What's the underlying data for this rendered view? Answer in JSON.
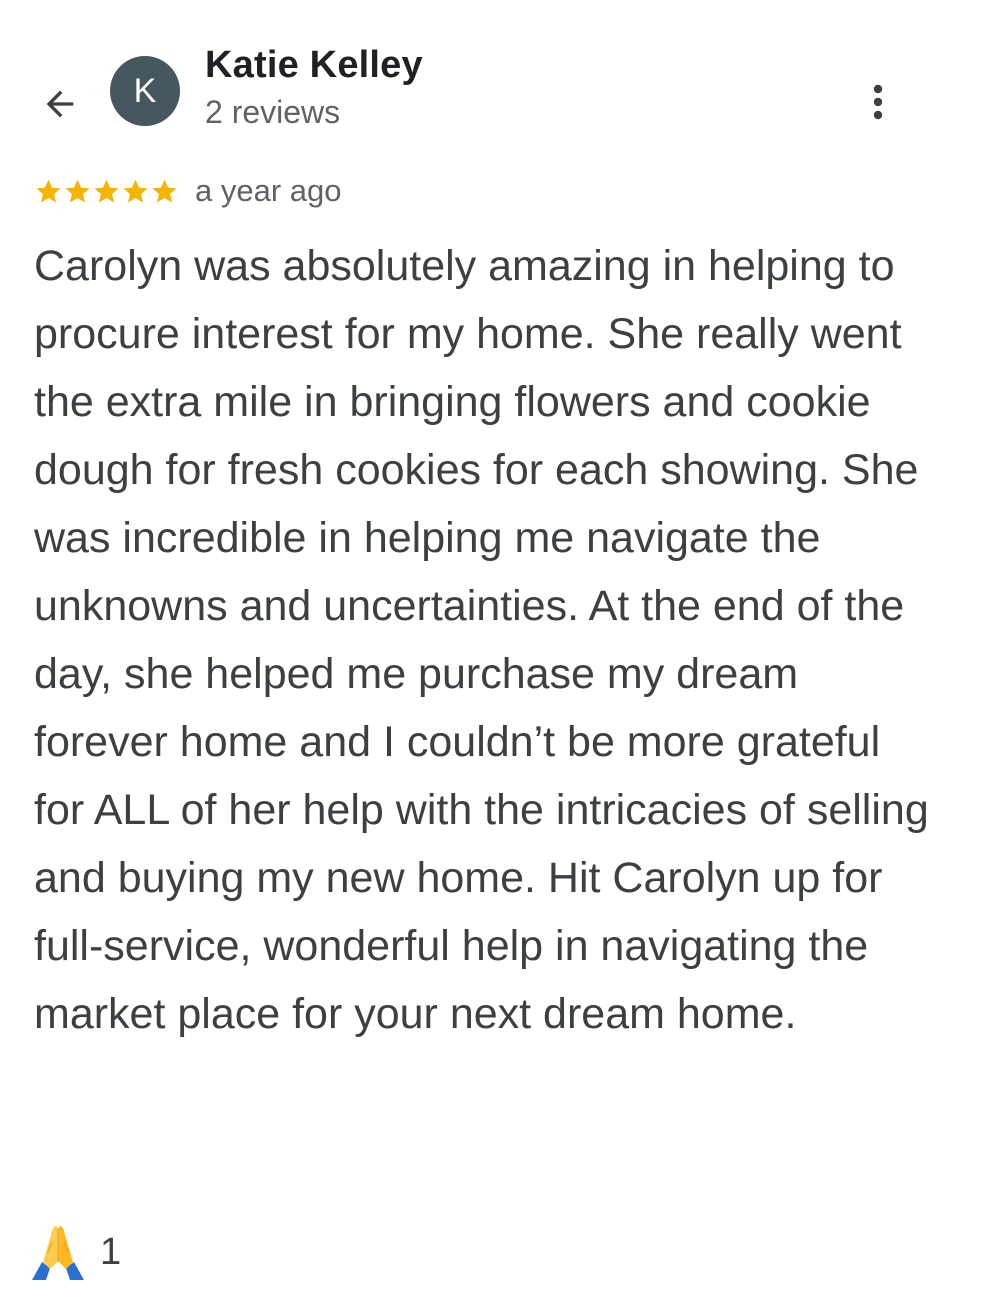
{
  "reviewer": {
    "avatar_letter": "K",
    "avatar_color": "#46575f",
    "name": "Katie Kelley",
    "review_count": "2 reviews"
  },
  "header": {
    "back_icon": "arrow-left-icon",
    "menu_icon": "more-vert-icon"
  },
  "review": {
    "rating": 5,
    "rating_max": 5,
    "star_color": "#f4b400",
    "time": "a year ago",
    "text": "Carolyn was absolutely amazing in helping to procure interest for my home. She really went the extra mile in bringing flowers and cookie dough for fresh cookies for each showing. She was incredible in helping me navigate the unknowns and uncertainties. At the end of the day, she helped me purchase my dream forever home and I couldn’t be more grateful for ALL of her help with the intricacies of selling and buying my new home. Hit Carolyn up for full-service, wonderful help in navigating the market place for your next dream home."
  },
  "reaction": {
    "icon": "folded-hands-icon",
    "count": "1"
  }
}
